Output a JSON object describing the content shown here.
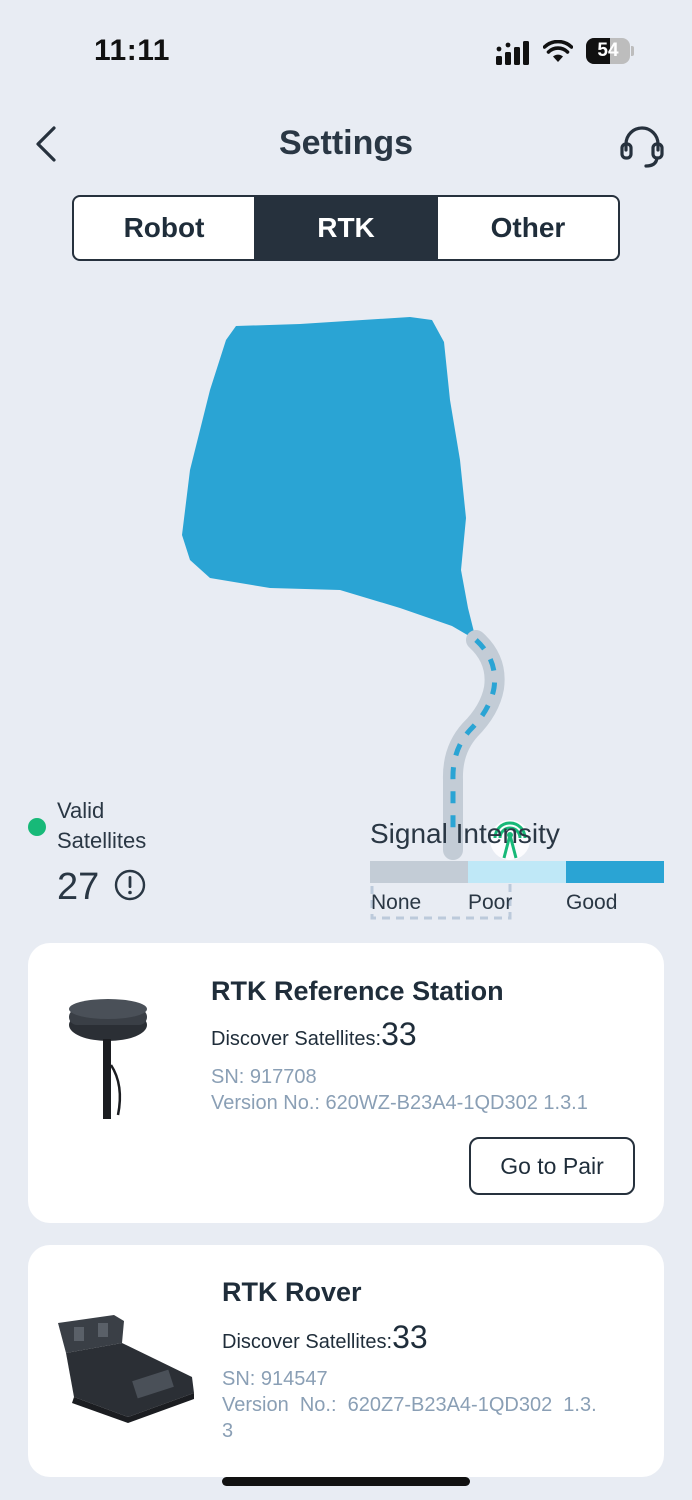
{
  "status_bar": {
    "time": "11:11",
    "battery": "54",
    "battery_level": 0.54
  },
  "header": {
    "title": "Settings"
  },
  "tabs": [
    {
      "label": "Robot",
      "active": false
    },
    {
      "label": "RTK",
      "active": true
    },
    {
      "label": "Other",
      "active": false
    }
  ],
  "satellites": {
    "label_line1": "Valid",
    "label_line2": "Satellites",
    "count": "27"
  },
  "signal": {
    "title": "Signal Intensity",
    "levels": [
      {
        "label": "None",
        "color": "#c3ccd6"
      },
      {
        "label": "Poor",
        "color": "#bfe8f7"
      },
      {
        "label": "Good",
        "color": "#2aa4d4"
      }
    ]
  },
  "colors": {
    "accent_dark": "#26313d",
    "map_area": "#2aa4d4",
    "valid_dot": "#17b978",
    "meta_text": "#8a9fb5"
  },
  "devices": {
    "station": {
      "title": "RTK Reference Station",
      "discover_label": "Discover Satellites:",
      "discover_count": "33",
      "sn": "SN: 917708",
      "version": "Version No.: 620WZ-B23A4-1QD302 1.3.1",
      "pair_label": "Go to Pair"
    },
    "rover": {
      "title": "RTK Rover",
      "discover_label": "Discover Satellites:",
      "discover_count": "33",
      "sn": "SN: 914547",
      "version_line1": "Version  No.:  620Z7-B23A4-1QD302  1.3.",
      "version_line2": "3"
    }
  }
}
